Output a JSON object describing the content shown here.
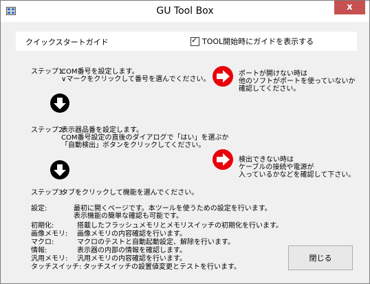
{
  "window": {
    "title": "GU Tool Box",
    "close_glyph": "x"
  },
  "header": {
    "guide_title": "クイックスタートガイド",
    "checkbox_label": "TOOL開始時にガイドを表示する",
    "checkbox_checked": true
  },
  "steps": [
    {
      "label": "ステップ1:",
      "lines": [
        "COM番号を設定します。",
        "∨マークをクリックして番号を選んでください。"
      ]
    },
    {
      "label": "ステップ2:",
      "lines": [
        "表示器品番を設定します。",
        "COM番号設定の直後のダイアログで「はい」を選ぶか",
        "「自動検出」ボタンをクリックしてください。"
      ]
    },
    {
      "label": "ステップ3:",
      "lines": [
        "タブをクリックして機能を選んでください。"
      ]
    }
  ],
  "notes": [
    {
      "lines": [
        "ポートが開けない時は",
        "他のソフトがポートを使っていないか",
        "確認してください。"
      ]
    },
    {
      "lines": [
        "検出できない時は",
        "ケーブルの接続や電源が",
        "入っているかなどを確認して下さい。"
      ]
    }
  ],
  "descriptions": [
    {
      "label": "設定:",
      "text": "最初に開くページです。本ツールを使うための設定を行います。"
    },
    {
      "label": "",
      "text": "表示機能の簡単な確認も可能です。"
    },
    {
      "label": "初期化:",
      "text": "搭載したフラッシュメモリとメモリスイッチの初期化を行います。"
    },
    {
      "label": "画像メモリ:",
      "text": "画像メモリの内容確認を行います。"
    },
    {
      "label": "マクロ:",
      "text": "マクロのテストと自動起動設定、解除を行います。"
    },
    {
      "label": "情報:",
      "text": "表示器の内部の情報を確認します。"
    },
    {
      "label": "汎用メモリ:",
      "text": "汎用メモリの内容確認を行います。"
    },
    {
      "label": "タッチスイッチ:",
      "text": "タッチスイッチの設置値変更とテストを行います。"
    }
  ],
  "buttons": {
    "close_label": "閉じる"
  },
  "icons": {
    "down_arrow": "down-arrow-icon",
    "note_arrow": "right-arrow-icon",
    "note_color": "#e8000b"
  }
}
